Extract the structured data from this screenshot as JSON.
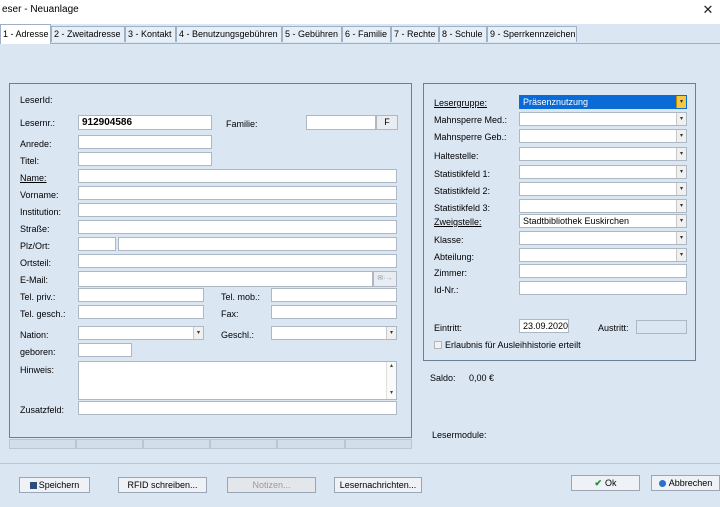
{
  "window": {
    "title": "eser - Neuanlage",
    "close_glyph": "✕"
  },
  "tabs": [
    "1 - Adresse",
    "2 - Zweitadresse",
    "3 - Kontakt",
    "4 - Benutzungsgebühren",
    "5 - Gebühren",
    "6 - Familie",
    "7 - Rechte",
    "8 - Schule",
    "9 - Sperrkennzeichen"
  ],
  "left": {
    "leserid_label": "LeserId:",
    "lesernr_label": "Lesernr.:",
    "lesernr_value": "912904586",
    "familie_label": "Familie:",
    "familie_button": "F",
    "anrede_label": "Anrede:",
    "titel_label": "Titel:",
    "name_label": "Name:",
    "vorname_label": "Vorname:",
    "institution_label": "Institution:",
    "strasse_label": "Straße:",
    "plzort_label": "Plz/Ort:",
    "ortsteil_label": "Ortsteil:",
    "email_label": "E-Mail:",
    "telpriv_label": "Tel. priv.:",
    "telmob_label": "Tel. mob.:",
    "telgesch_label": "Tel. gesch.:",
    "fax_label": "Fax:",
    "nation_label": "Nation:",
    "geschl_label": "Geschl.:",
    "geboren_label": "geboren:",
    "hinweis_label": "Hinweis:",
    "zusatzfeld_label": "Zusatzfeld:"
  },
  "right": {
    "lesergruppe_label": "Lesergruppe:",
    "lesergruppe_value": "Präsenznutzung",
    "mahnsperre_med_label": "Mahnsperre Med.:",
    "mahnsperre_geb_label": "Mahnsperre Geb.:",
    "haltestelle_label": "Haltestelle:",
    "statistik1_label": "Statistikfeld 1:",
    "statistik2_label": "Statistikfeld 2:",
    "statistik3_label": "Statistikfeld 3:",
    "zweigstelle_label": "Zweigstelle:",
    "zweigstelle_value": "Stadtbibliothek Euskirchen",
    "klasse_label": "Klasse:",
    "abteilung_label": "Abteilung:",
    "zimmer_label": "Zimmer:",
    "idnr_label": "Id-Nr.:",
    "eintritt_label": "Eintritt:",
    "eintritt_value": "23.09.2020",
    "austritt_label": "Austritt:",
    "erlaubnis_label": "Erlaubnis für Ausleihhistorie erteilt"
  },
  "saldo": {
    "label": "Saldo:",
    "value": "0,00 €"
  },
  "lesermodule_label": "Lesermodule:",
  "buttons": {
    "speichern": "Speichern",
    "rfid": "RFID schreiben...",
    "notizen": "Notizen...",
    "lesernachrichten": "Lesernachrichten...",
    "ok": "Ok",
    "abbrechen": "Abbrechen"
  },
  "colors": {
    "background": "#dbe6f3",
    "selection": "#0a6ad6",
    "dropdown_accent": "#f4c842"
  }
}
